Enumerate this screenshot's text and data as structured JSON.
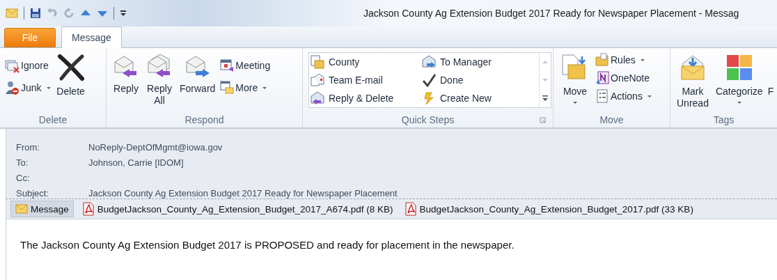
{
  "window": {
    "title": "Jackson County Ag Extension Budget 2017 Ready for Newspaper Placement  -  Messag"
  },
  "tabs": [
    {
      "label": "File",
      "kind": "file",
      "selected": false
    },
    {
      "label": "Message",
      "kind": "tab",
      "selected": true
    }
  ],
  "ribbon": {
    "groups": [
      {
        "label": "Delete",
        "items": [
          {
            "kind": "small",
            "label": "Ignore",
            "dropdown": false
          },
          {
            "kind": "small",
            "label": "Junk",
            "dropdown": true
          },
          {
            "kind": "large",
            "label": "Delete",
            "dropdown": false
          }
        ]
      },
      {
        "label": "Respond",
        "items": [
          {
            "kind": "large",
            "label": "Reply",
            "dropdown": false
          },
          {
            "kind": "large",
            "label": "Reply All",
            "dropdown": false
          },
          {
            "kind": "large",
            "label": "Forward",
            "dropdown": false
          },
          {
            "kind": "small",
            "label": "Meeting",
            "dropdown": false
          },
          {
            "kind": "small",
            "label": "More",
            "dropdown": true
          }
        ]
      },
      {
        "label": "Quick Steps",
        "launcher": true,
        "items": [
          {
            "kind": "gallery",
            "steps": [
              "County",
              "Team E-mail",
              "Reply & Delete",
              "To Manager",
              "Done",
              "Create New"
            ]
          }
        ]
      },
      {
        "label": "Move",
        "items": [
          {
            "kind": "large",
            "label": "Move",
            "dropdown": true
          },
          {
            "kind": "small",
            "label": "Rules",
            "dropdown": true
          },
          {
            "kind": "small",
            "label": "OneNote",
            "dropdown": false
          },
          {
            "kind": "small",
            "label": "Actions",
            "dropdown": true
          }
        ]
      },
      {
        "label": "Tags",
        "items": [
          {
            "kind": "large",
            "label": "Mark Unread",
            "dropdown": false
          },
          {
            "kind": "large",
            "label": "Categorize",
            "dropdown": true
          },
          {
            "kind": "cut",
            "label": "F"
          }
        ]
      }
    ]
  },
  "header": {
    "fields": [
      {
        "label": "From:",
        "value": "NoReply-DeptOfMgmt@iowa.gov"
      },
      {
        "label": "To:",
        "value": "Johnson, Carrie [IDOM]"
      },
      {
        "label": "Cc:"
      },
      {
        "label": "Subject:",
        "value": "Jackson County Ag Extension Budget 2017 Ready for Newspaper Placement"
      }
    ]
  },
  "attachments": [
    {
      "kind": "message",
      "label": "Message",
      "selected": true
    },
    {
      "kind": "pdf",
      "label": "BudgetJackson_County_Ag_Extension_Budget_2017_A674.pdf (8 KB)",
      "selected": false
    },
    {
      "kind": "pdf",
      "label": "BudgetJackson_County_Ag_Extension_Budget_2017.pdf (33 KB)",
      "selected": false
    }
  ],
  "body": "The Jackson County Ag Extension Budget 2017 is PROPOSED and ready for placement in the newspaper."
}
